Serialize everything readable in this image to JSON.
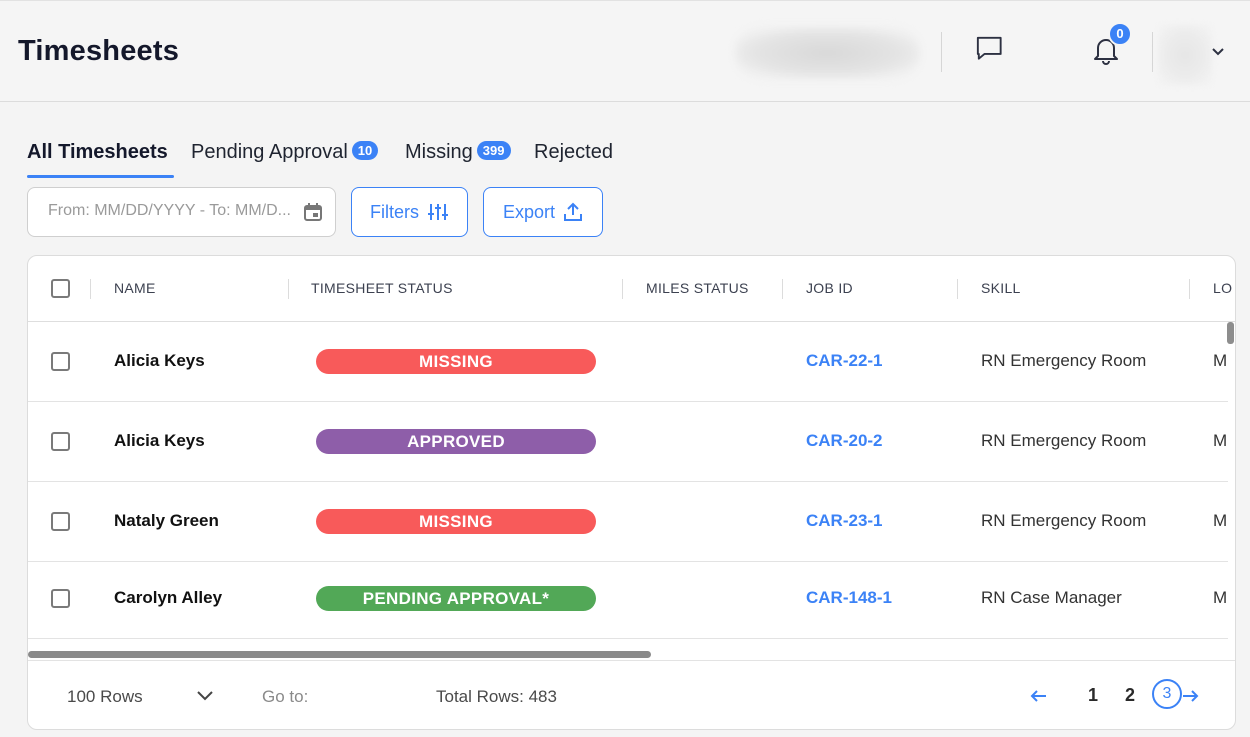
{
  "header": {
    "title": "Timesheets",
    "notifications_count": "0"
  },
  "tabs": [
    {
      "label": "All Timesheets",
      "active": true
    },
    {
      "label": "Pending Approval",
      "badge": "10"
    },
    {
      "label": "Missing",
      "badge": "399"
    },
    {
      "label": "Rejected"
    }
  ],
  "toolbar": {
    "date_placeholder": "From: MM/DD/YYYY - To: MM/D...",
    "filters_label": "Filters",
    "export_label": "Export"
  },
  "table": {
    "columns": [
      "NAME",
      "TIMESHEET STATUS",
      "MILES STATUS",
      "JOB ID",
      "SKILL",
      "LO"
    ],
    "rows": [
      {
        "name": "Alicia Keys",
        "status": "MISSING",
        "status_color": "#f85a5a",
        "miles": "",
        "job_id": "CAR-22-1",
        "skill": "RN Emergency Room",
        "loc": "M"
      },
      {
        "name": "Alicia Keys",
        "status": "APPROVED",
        "status_color": "#8e5ea9",
        "miles": "",
        "job_id": "CAR-20-2",
        "skill": "RN Emergency Room",
        "loc": "M"
      },
      {
        "name": "Nataly Green",
        "status": "MISSING",
        "status_color": "#f85a5a",
        "miles": "",
        "job_id": "CAR-23-1",
        "skill": "RN Emergency Room",
        "loc": "M"
      },
      {
        "name": "Carolyn Alley",
        "status": "PENDING APPROVAL*",
        "status_color": "#52a857",
        "miles": "",
        "job_id": "CAR-148-1",
        "skill": "RN Case Manager",
        "loc": "M"
      }
    ]
  },
  "footer": {
    "rows_select": "100 Rows",
    "goto_label": "Go to:",
    "total_rows": "Total Rows: 483",
    "pages": [
      "1",
      "2"
    ],
    "current_page": "3"
  },
  "colors": {
    "accent": "#3b82f6",
    "missing": "#f85a5a",
    "approved": "#8e5ea9",
    "pending": "#52a857"
  }
}
